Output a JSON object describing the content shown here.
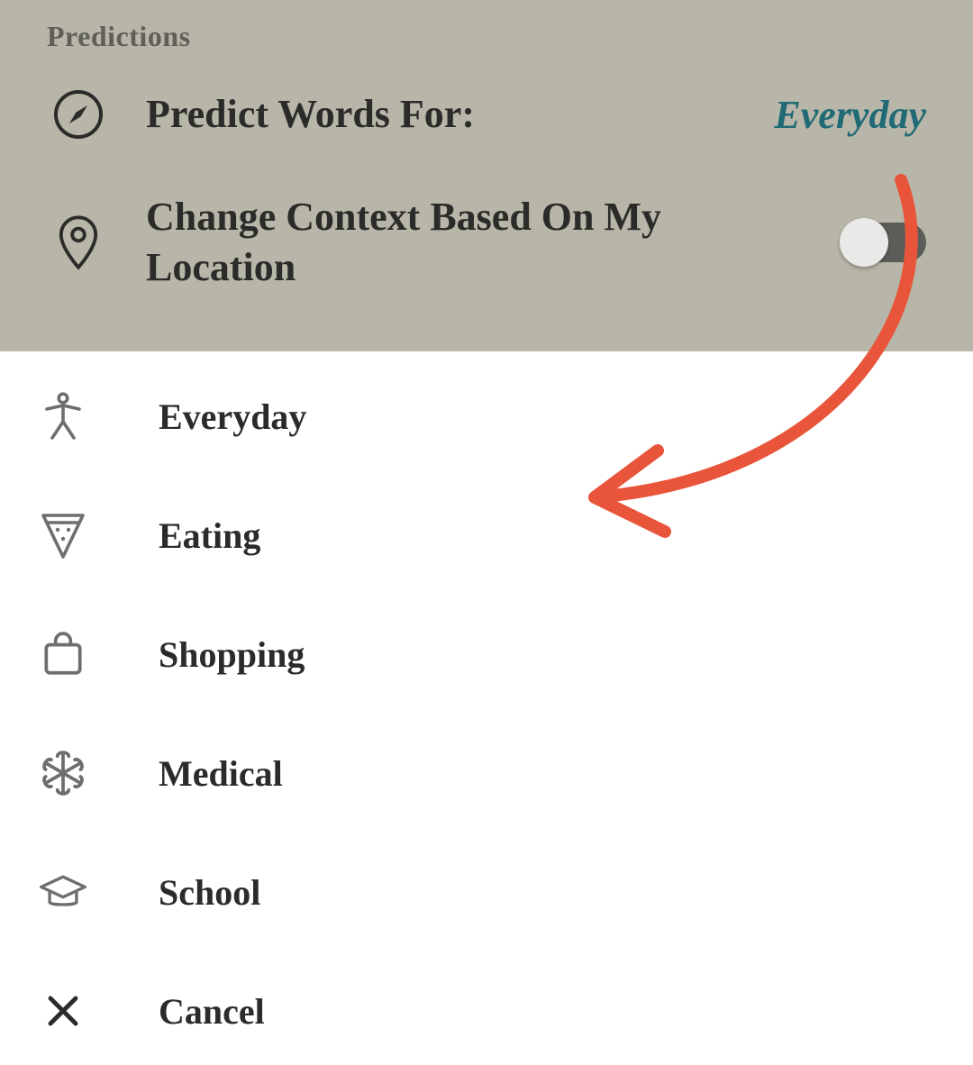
{
  "section_header": "Predictions",
  "predict_row": {
    "label": "Predict Words For:",
    "value": "Everyday"
  },
  "location_row": {
    "label": "Change Context Based On My Location",
    "toggle_on": false
  },
  "menu": {
    "items": [
      {
        "icon": "accessibility-icon",
        "label": "Everyday"
      },
      {
        "icon": "pizza-icon",
        "label": "Eating"
      },
      {
        "icon": "shopping-bag-icon",
        "label": "Shopping"
      },
      {
        "icon": "medical-icon",
        "label": "Medical"
      },
      {
        "icon": "graduation-cap-icon",
        "label": "School"
      },
      {
        "icon": "close-icon",
        "label": "Cancel"
      }
    ]
  },
  "annotation": {
    "color": "#e8553a"
  }
}
